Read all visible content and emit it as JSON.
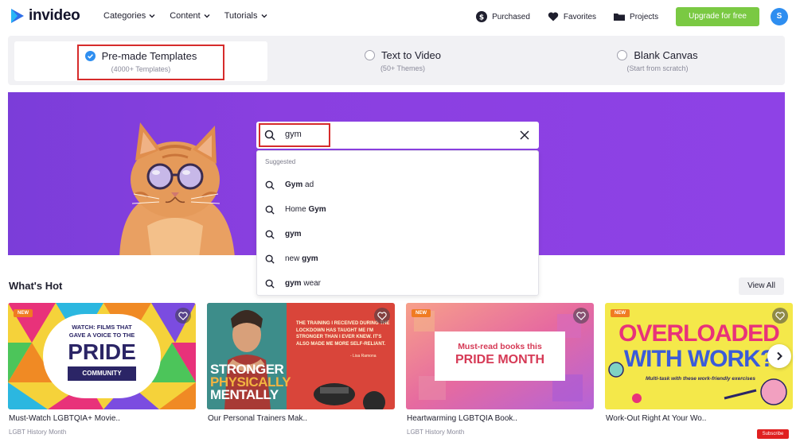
{
  "brand": {
    "name": "invideo"
  },
  "nav": {
    "menu": [
      "Categories",
      "Content",
      "Tutorials"
    ],
    "purchased": "Purchased",
    "favorites": "Favorites",
    "projects": "Projects",
    "upgrade": "Upgrade for free",
    "avatar": "S"
  },
  "modes": [
    {
      "label": "Pre-made Templates",
      "sub": "(4000+ Templates)",
      "selected": true
    },
    {
      "label": "Text to Video",
      "sub": "(50+ Themes)",
      "selected": false
    },
    {
      "label": "Blank Canvas",
      "sub": "(Start from scratch)",
      "selected": false
    }
  ],
  "search": {
    "value": "gym",
    "suggested_label": "Suggested",
    "suggestions": [
      {
        "bold": "Gym",
        "rest": " ad",
        "bold_first": true
      },
      {
        "bold": "Gym",
        "rest": "Home ",
        "bold_first": false
      },
      {
        "bold": "gym",
        "rest": "",
        "bold_first": true
      },
      {
        "bold": "gym",
        "rest": "new ",
        "bold_first": false
      },
      {
        "bold": "gym",
        "rest": " wear",
        "bold_first": true
      }
    ]
  },
  "whats_hot": {
    "title": "What's Hot",
    "view_all": "View All",
    "cards": [
      {
        "badge": "NEW",
        "title": "Must-Watch LGBTQIA+ Movie..",
        "sub": "LGBT History Month",
        "art": {
          "line1": "WATCH: FILMS THAT",
          "line2": "GAVE A VOICE TO THE",
          "big": "PRIDE",
          "pill": "COMMUNITY"
        }
      },
      {
        "badge": "",
        "title": "Our Personal Trainers Mak..",
        "sub": "",
        "art": {
          "quote": "THE TRAINING I RECEIVED DURING THE LOCKDOWN HAS TAUGHT ME I'M STRONGER THAN I EVER KNEW. IT'S ALSO MADE ME MORE SELF-RELIANT.",
          "author": "- Lisa Ramona",
          "w1": "STRONGER",
          "w2": "PHYSICALLY",
          "w3": "MENTALLY"
        }
      },
      {
        "badge": "NEW",
        "title": "Heartwarming LGBTQIA Book..",
        "sub": "LGBT History Month",
        "art": {
          "line1": "Must-read books this",
          "big": "PRIDE MONTH"
        }
      },
      {
        "badge": "NEW",
        "title": "Work-Out Right At Your Wo..",
        "sub": "",
        "art": {
          "line1": "OVERLOADED",
          "line2": "WITH WORK?",
          "line3": "Multi-task with these work-friendly exercises"
        }
      }
    ]
  },
  "yt_badge": "Subscribe"
}
